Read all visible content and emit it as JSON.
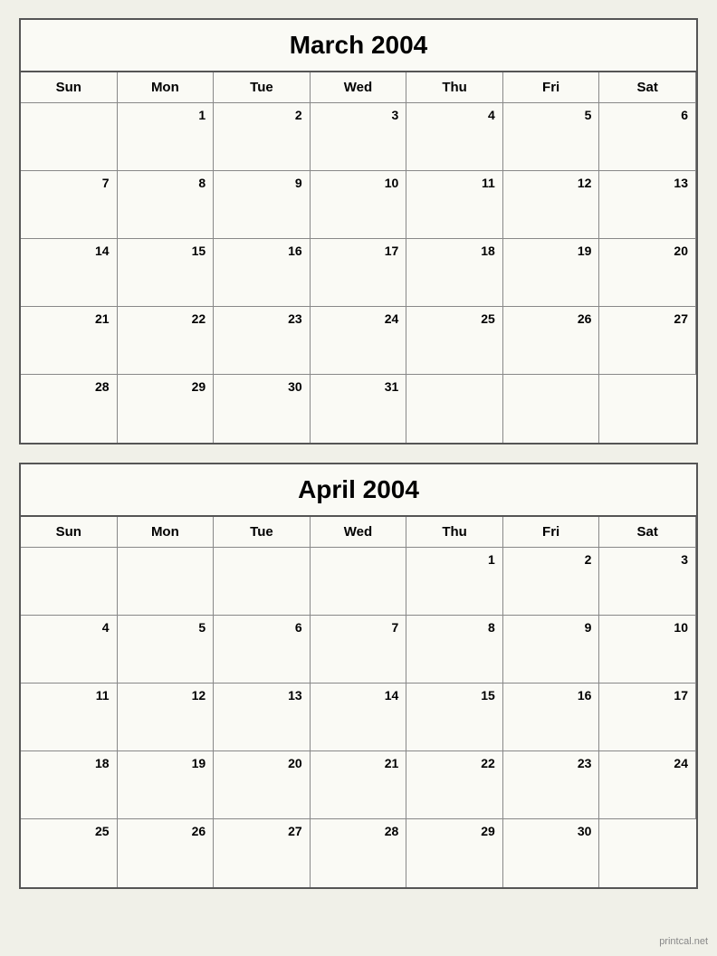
{
  "march": {
    "title": "March 2004",
    "headers": [
      "Sun",
      "Mon",
      "Tue",
      "Wed",
      "Thu",
      "Fri",
      "Sat"
    ],
    "weeks": [
      [
        "",
        "1",
        "2",
        "3",
        "4",
        "5",
        "6"
      ],
      [
        "7",
        "8",
        "9",
        "10",
        "11",
        "12",
        "13"
      ],
      [
        "14",
        "15",
        "16",
        "17",
        "18",
        "19",
        "20"
      ],
      [
        "21",
        "22",
        "23",
        "24",
        "25",
        "26",
        "27"
      ],
      [
        "28",
        "29",
        "30",
        "31",
        "",
        "",
        ""
      ]
    ]
  },
  "april": {
    "title": "April 2004",
    "headers": [
      "Sun",
      "Mon",
      "Tue",
      "Wed",
      "Thu",
      "Fri",
      "Sat"
    ],
    "weeks": [
      [
        "",
        "",
        "",
        "",
        "1",
        "2",
        "3"
      ],
      [
        "4",
        "5",
        "6",
        "7",
        "8",
        "9",
        "10"
      ],
      [
        "11",
        "12",
        "13",
        "14",
        "15",
        "16",
        "17"
      ],
      [
        "18",
        "19",
        "20",
        "21",
        "22",
        "23",
        "24"
      ],
      [
        "25",
        "26",
        "27",
        "28",
        "29",
        "30",
        ""
      ]
    ]
  },
  "watermark": "printcal.net"
}
